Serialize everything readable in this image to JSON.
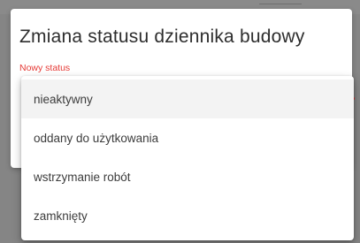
{
  "dialog": {
    "title": "Zmiana statusu dziennika budowy",
    "field_label": "Nowy status"
  },
  "dropdown": {
    "options": [
      {
        "label": "nieaktywny",
        "selected": true
      },
      {
        "label": "oddany do użytkowania",
        "selected": false
      },
      {
        "label": "wstrzymanie robót",
        "selected": false
      },
      {
        "label": "zamknięty",
        "selected": false
      }
    ]
  },
  "colors": {
    "label_red": "#e53935",
    "overlay": "#858585",
    "selected_bg": "#f3f3f3"
  }
}
